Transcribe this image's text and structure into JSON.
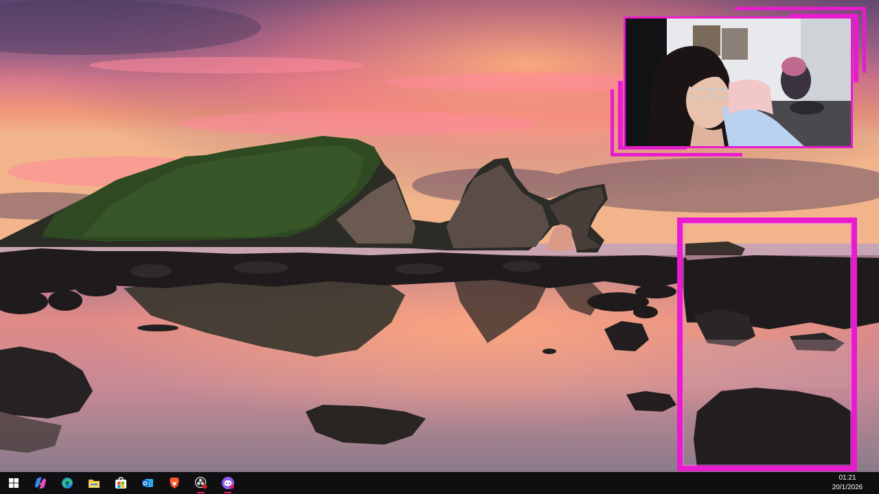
{
  "taskbar": {
    "apps": [
      {
        "name": "windows-start",
        "active": false
      },
      {
        "name": "copilot",
        "active": false
      },
      {
        "name": "edge",
        "active": false
      },
      {
        "name": "file-explorer",
        "active": false
      },
      {
        "name": "microsoft-store",
        "active": false
      },
      {
        "name": "outlook",
        "active": false
      },
      {
        "name": "brave",
        "active": false
      },
      {
        "name": "obs-studio",
        "active": true
      },
      {
        "name": "discord-like-app",
        "active": true
      }
    ],
    "clock": {
      "time": "01:21",
      "date": "20/1/2026"
    }
  },
  "colors": {
    "overlay_accent": "#e81ccf",
    "taskbar_bg": "#0f0f12"
  }
}
